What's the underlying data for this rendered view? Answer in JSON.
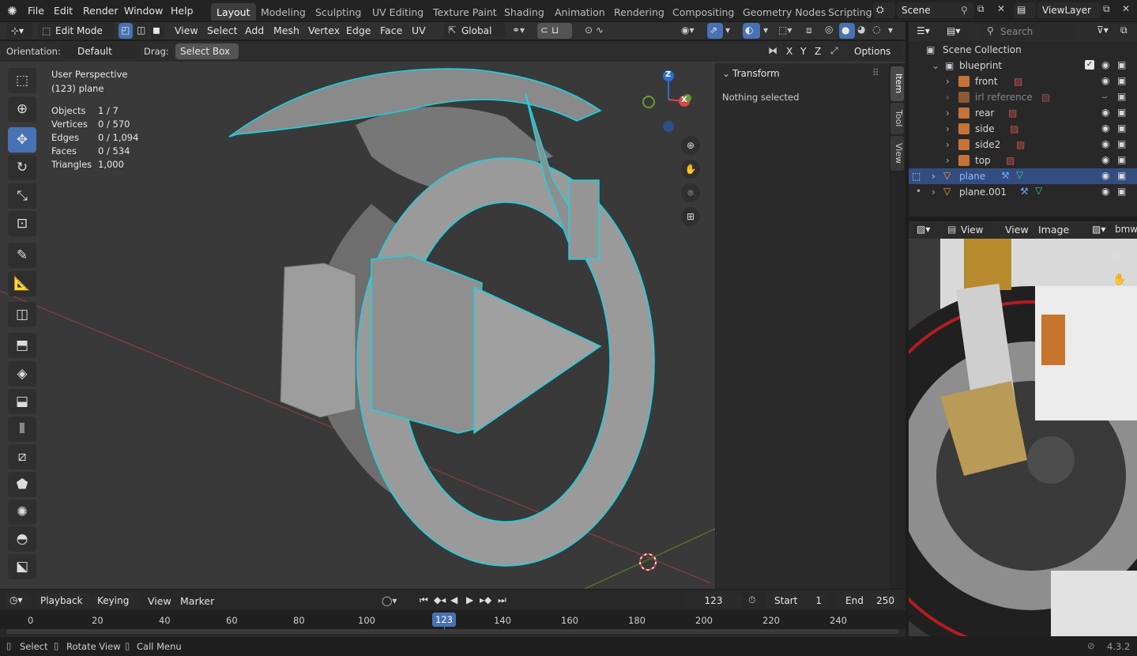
{
  "menu": {
    "file": "File",
    "edit": "Edit",
    "render": "Render",
    "window": "Window",
    "help": "Help"
  },
  "workspaces": [
    "Layout",
    "Modeling",
    "Sculpting",
    "UV Editing",
    "Texture Paint",
    "Shading",
    "Animation",
    "Rendering",
    "Compositing",
    "Geometry Nodes",
    "Scripting"
  ],
  "scene": {
    "scene_name": "Scene",
    "view_layer": "ViewLayer"
  },
  "viewport_header": {
    "mode": "Edit Mode",
    "view": "View",
    "select": "Select",
    "add": "Add",
    "mesh": "Mesh",
    "vertex": "Vertex",
    "edge": "Edge",
    "face": "Face",
    "uv": "UV",
    "transform_orientation": "Global"
  },
  "tool_settings": {
    "orientation_label": "Orientation:",
    "orientation_value": "Default",
    "drag_label": "Drag:",
    "drag_value": "Select Box",
    "x": "X",
    "y": "Y",
    "z": "Z",
    "options": "Options"
  },
  "overlay_text": {
    "perspective": "User Perspective",
    "object": "(123) plane"
  },
  "stats": [
    {
      "label": "Objects",
      "value": "1 / 7"
    },
    {
      "label": "Vertices",
      "value": "0 / 570"
    },
    {
      "label": "Edges",
      "value": "0 / 1,094"
    },
    {
      "label": "Faces",
      "value": "0 / 534"
    },
    {
      "label": "Triangles",
      "value": "1,000"
    }
  ],
  "gizmo": {
    "z": "Z",
    "x": "X"
  },
  "npanel": {
    "section": "Transform",
    "message": "Nothing selected",
    "tabs": [
      "Item",
      "Tool",
      "View"
    ]
  },
  "outliner": {
    "search_placeholder": "Search",
    "root": "Scene Collection",
    "items": [
      {
        "name": "blueprint"
      },
      {
        "name": "front"
      },
      {
        "name": "irl reference"
      },
      {
        "name": "rear"
      },
      {
        "name": "side"
      },
      {
        "name": "side2"
      },
      {
        "name": "top"
      },
      {
        "name": "plane"
      },
      {
        "name": "plane.001"
      }
    ]
  },
  "image_editor": {
    "view": "View",
    "view2": "View",
    "image": "Image",
    "image_name": "bmw"
  },
  "timeline": {
    "playback": "Playback",
    "keying": "Keying",
    "view": "View",
    "marker": "Marker",
    "current_frame": "123",
    "start_label": "Start",
    "start": "1",
    "end_label": "End",
    "end": "250",
    "ticks": [
      "0",
      "20",
      "40",
      "60",
      "80",
      "100",
      "120",
      "140",
      "160",
      "180",
      "200",
      "220",
      "240"
    ],
    "playhead": "123"
  },
  "statusbar": {
    "select": "Select",
    "rotate": "Rotate View",
    "menu": "Call Menu",
    "version": "4.3.2"
  }
}
